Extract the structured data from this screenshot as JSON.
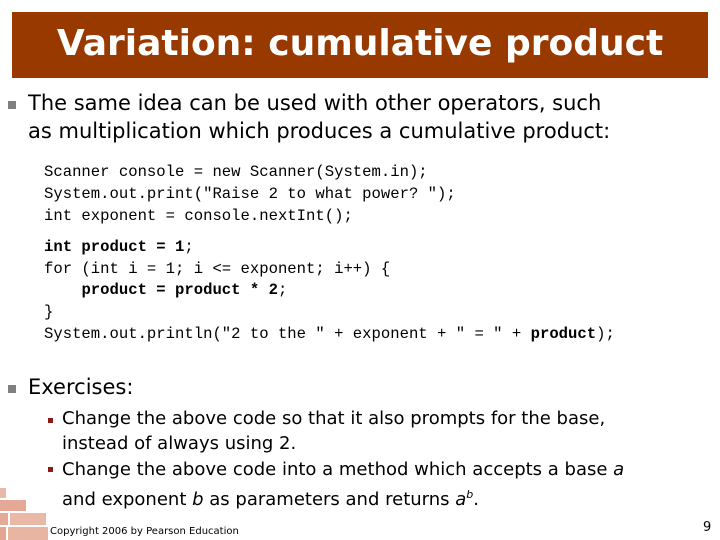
{
  "slide": {
    "title": "Variation: cumulative product",
    "intro_line1": "The same idea can be used with other operators, such",
    "intro_line2": "as multiplication which produces a cumulative product:",
    "code_block1": [
      "Scanner console = new Scanner(System.in);",
      "System.out.print(\"Raise 2 to what power? \");",
      "int exponent = console.nextInt();"
    ],
    "code_block2": {
      "line1_bold": "int product = 1",
      "line1_rest": ";",
      "line2": "for (int i = 1; i <= exponent; i++) {",
      "line3_indent": "    ",
      "line3_bold": "product = product * 2",
      "line3_rest": ";",
      "line4": "}",
      "line5_pre": "System.out.println(\"2 to the \" + exponent + \" = \" + ",
      "line5_bold": "product",
      "line5_post": ");"
    },
    "exercises_heading": "Exercises:",
    "exercise1_line1": "Change the above code so that it also prompts for the base,",
    "exercise1_line2": "instead of always using 2.",
    "exercise2_line1_pre": "Change the above code into a method which accepts a base ",
    "exercise2_line1_var": "a",
    "exercise2_line2_pre": "and exponent ",
    "exercise2_line2_var_b": "b",
    "exercise2_line2_mid": " as parameters and returns ",
    "exercise2_line2_base": "a",
    "exercise2_line2_exp": "b",
    "exercise2_line2_end": ".",
    "footer": "Copyright 2006 by Pearson Education",
    "page_number": "9"
  },
  "colors": {
    "title_bar": "#983a00",
    "bullet_level1": "#808080",
    "bullet_level2": "#8b1a1a"
  }
}
